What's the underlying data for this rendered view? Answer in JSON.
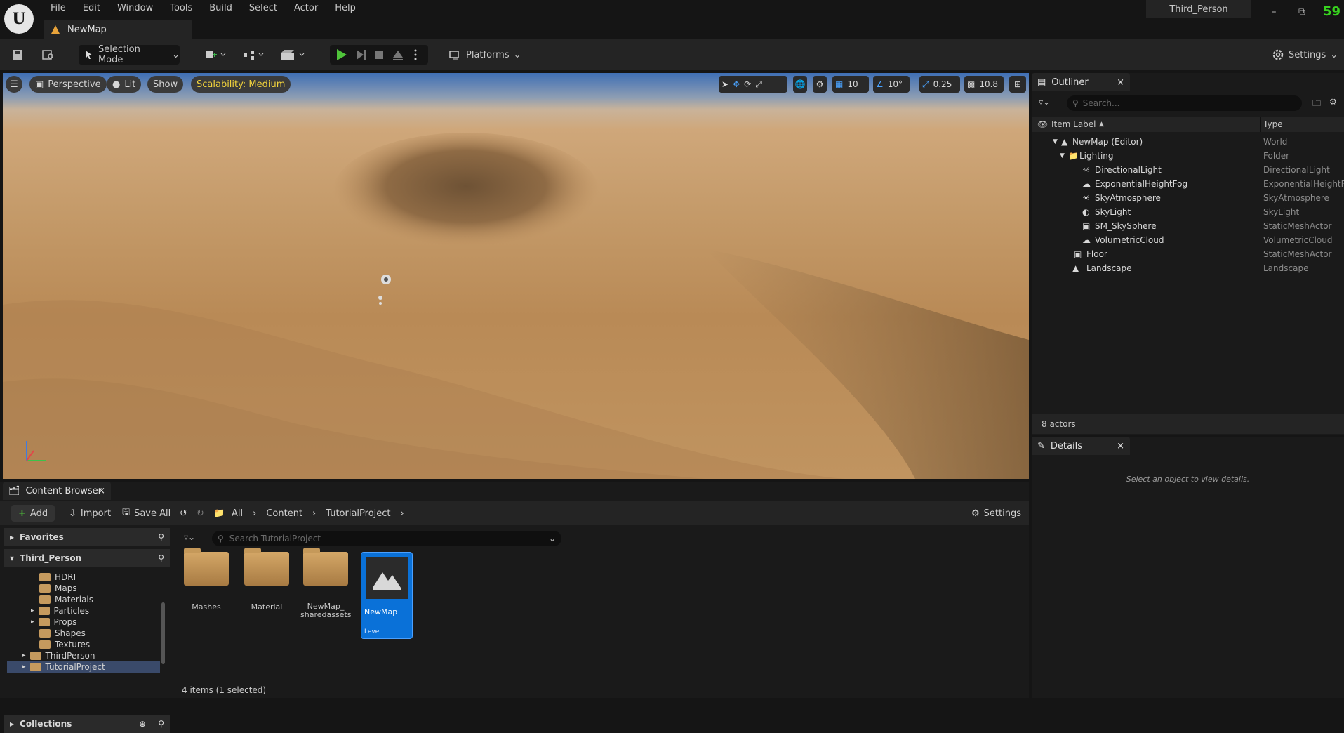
{
  "menu": [
    "File",
    "Edit",
    "Window",
    "Tools",
    "Build",
    "Select",
    "Actor",
    "Help"
  ],
  "doc_tab": "NewMap",
  "project_name": "Third_Person",
  "fps": "59",
  "toolbar": {
    "selection_mode": "Selection Mode",
    "platforms": "Platforms",
    "settings": "Settings"
  },
  "viewport": {
    "perspective": "Perspective",
    "lit": "Lit",
    "show": "Show",
    "scalability": "Scalability: Medium",
    "grid_snap": "10",
    "rot_snap": "10°",
    "scale_snap": "0.25",
    "cam_speed": "10.8"
  },
  "outliner": {
    "tab": "Outliner",
    "search_placeholder": "Search...",
    "col_label": "Item Label",
    "col_type": "Type",
    "rows": [
      {
        "label": "NewMap (Editor)",
        "type": "World"
      },
      {
        "label": "Lighting",
        "type": "Folder"
      },
      {
        "label": "DirectionalLight",
        "type": "DirectionalLight"
      },
      {
        "label": "ExponentialHeightFog",
        "type": "ExponentialHeightFo"
      },
      {
        "label": "SkyAtmosphere",
        "type": "SkyAtmosphere"
      },
      {
        "label": "SkyLight",
        "type": "SkyLight"
      },
      {
        "label": "SM_SkySphere",
        "type": "StaticMeshActor"
      },
      {
        "label": "VolumetricCloud",
        "type": "VolumetricCloud"
      },
      {
        "label": "Floor",
        "type": "StaticMeshActor"
      },
      {
        "label": "Landscape",
        "type": "Landscape"
      }
    ],
    "actor_count": "8 actors"
  },
  "details": {
    "tab": "Details",
    "empty_text": "Select an object to view details."
  },
  "content_browser": {
    "tab": "Content Browser",
    "add": "Add",
    "import": "Import",
    "save_all": "Save All",
    "breadcrumb": [
      "All",
      "Content",
      "TutorialProject"
    ],
    "settings": "Settings",
    "favorites": "Favorites",
    "root": "Third_Person",
    "collections": "Collections",
    "tree": [
      "HDRI",
      "Maps",
      "Materials",
      "Particles",
      "Props",
      "Shapes",
      "Textures",
      "ThirdPerson",
      "TutorialProject"
    ],
    "search_placeholder": "Search TutorialProject",
    "assets": [
      {
        "name": "Mashes"
      },
      {
        "name": "Material"
      },
      {
        "name": "NewMap_\nsharedassets"
      },
      {
        "name": "NewMap",
        "kind": "Level"
      }
    ],
    "status": "4 items (1 selected)"
  }
}
